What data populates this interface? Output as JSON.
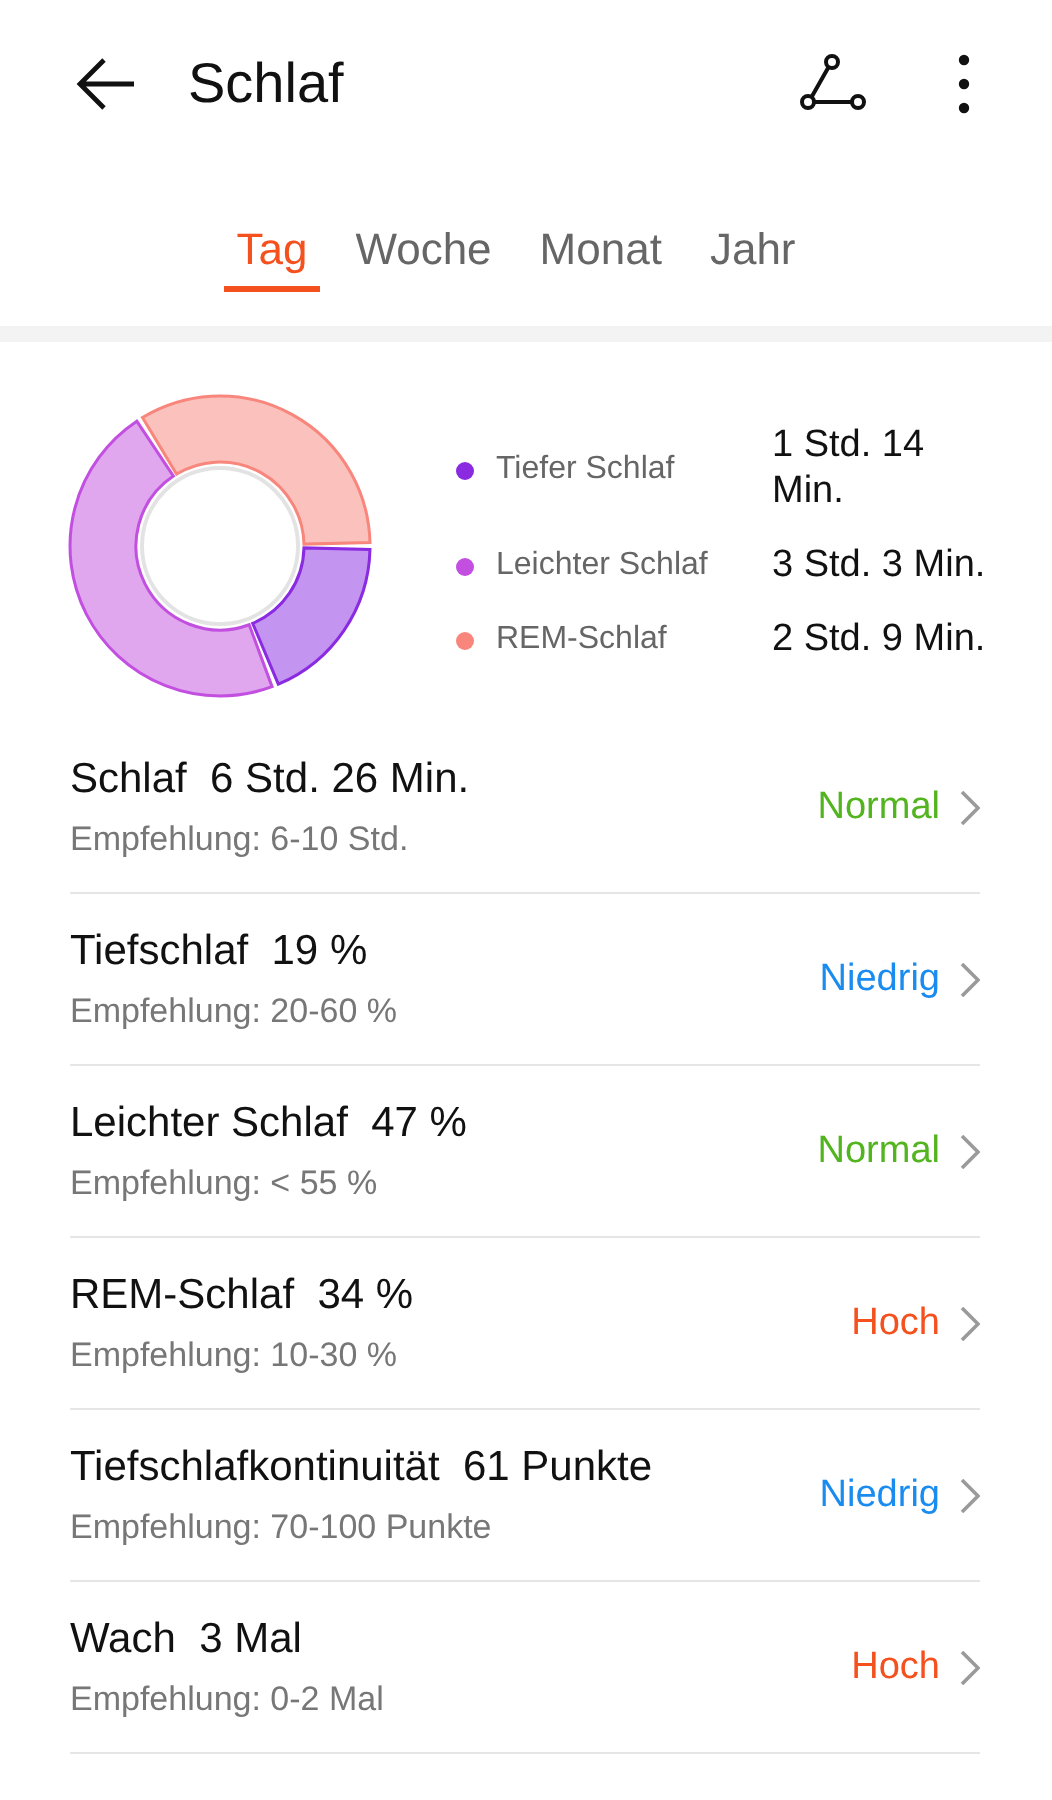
{
  "header": {
    "title": "Schlaf"
  },
  "tabs": [
    {
      "label": "Tag",
      "selected": true
    },
    {
      "label": "Woche",
      "selected": false
    },
    {
      "label": "Monat",
      "selected": false
    },
    {
      "label": "Jahr",
      "selected": false
    }
  ],
  "summary": {
    "chart_data": {
      "type": "donut",
      "categories": [
        "Tiefer Schlaf",
        "Leichter Schlaf",
        "REM-Schlaf"
      ],
      "values": [
        19,
        47,
        34
      ],
      "legend": true
    },
    "slices": [
      {
        "duration": "1 Std. 14 Min.",
        "color": "#8a2be2"
      },
      {
        "duration": "3 Std. 3 Min.",
        "color": "#c24fe0"
      },
      {
        "duration": "2 Std. 9 Min.",
        "color": "#f8867c"
      }
    ]
  },
  "metrics": [
    {
      "name": "Schlaf",
      "value": "6 Std. 26 Min.",
      "recommendation": "Empfehlung: 6-10 Std.",
      "status": "Normal",
      "kind": "normal"
    },
    {
      "name": "Tiefschlaf",
      "value": "19 %",
      "recommendation": "Empfehlung: 20-60 %",
      "status": "Niedrig",
      "kind": "low"
    },
    {
      "name": "Leichter Schlaf",
      "value": "47 %",
      "recommendation": "Empfehlung: < 55 %",
      "status": "Normal",
      "kind": "normal"
    },
    {
      "name": "REM-Schlaf",
      "value": "34 %",
      "recommendation": "Empfehlung: 10-30 %",
      "status": "Hoch",
      "kind": "high"
    },
    {
      "name": "Tiefschlafkontinuität",
      "value": "61 Punkte",
      "recommendation": "Empfehlung: 70-100 Punkte",
      "status": "Niedrig",
      "kind": "low"
    },
    {
      "name": "Wach",
      "value": "3 Mal",
      "recommendation": "Empfehlung: 0-2 Mal",
      "status": "Hoch",
      "kind": "high"
    }
  ]
}
